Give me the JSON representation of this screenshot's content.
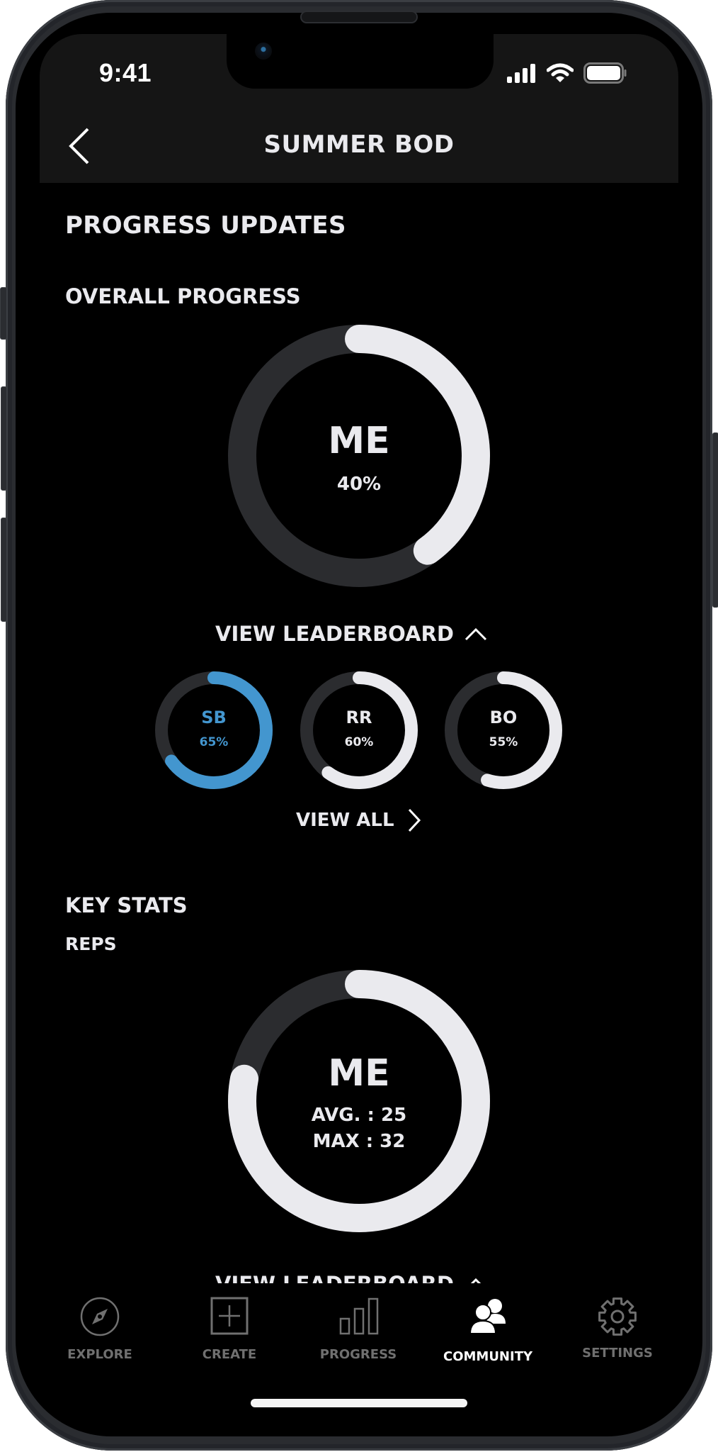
{
  "status_bar": {
    "time": "9:41",
    "icons": [
      "cellular-signal-icon",
      "wifi-icon",
      "battery-icon"
    ]
  },
  "nav": {
    "back_icon": "chevron-left-icon",
    "title": "SUMMER BOD"
  },
  "page": {
    "title": "PROGRESS UPDATES",
    "overall": {
      "heading": "OVERALL PROGRESS",
      "ring": {
        "name": "ME",
        "value_label": "40%",
        "progress": 0.4,
        "color": "#EAEAEE",
        "track_color": "#2B2C2F"
      },
      "leaderboard_toggle": {
        "label": "VIEW LEADERBOARD",
        "icon": "chevron-up-icon"
      },
      "leaderboard": [
        {
          "initials": "SB",
          "value_label": "65%",
          "progress": 0.65,
          "color": "#4396CF"
        },
        {
          "initials": "RR",
          "value_label": "60%",
          "progress": 0.6,
          "color": "#EAEAEE"
        },
        {
          "initials": "BO",
          "value_label": "55%",
          "progress": 0.55,
          "color": "#EAEAEE"
        }
      ],
      "view_all": {
        "label": "VIEW ALL",
        "icon": "chevron-right-icon"
      }
    },
    "key_stats": {
      "heading": "KEY STATS",
      "subheading": "REPS",
      "ring": {
        "name": "ME",
        "avg_label": "AVG. : 25",
        "max_label": "MAX : 32",
        "progress": 0.78,
        "color": "#EAEAEE",
        "track_color": "#2B2C2F"
      },
      "leaderboard_toggle": {
        "label": "VIEW LEADERBOARD",
        "icon": "chevron-up-icon"
      }
    }
  },
  "tabbar": {
    "active": "COMMUNITY",
    "items": [
      {
        "label": "EXPLORE",
        "icon": "compass-icon"
      },
      {
        "label": "CREATE",
        "icon": "plus-square-icon"
      },
      {
        "label": "PROGRESS",
        "icon": "bar-chart-icon"
      },
      {
        "label": "COMMUNITY",
        "icon": "users-icon"
      },
      {
        "label": "SETTINGS",
        "icon": "gear-icon"
      }
    ]
  },
  "colors": {
    "background": "#000000",
    "header_bg": "#151515",
    "text": "#EAEAEE",
    "accent": "#4396CF",
    "inactive": "#707070"
  }
}
